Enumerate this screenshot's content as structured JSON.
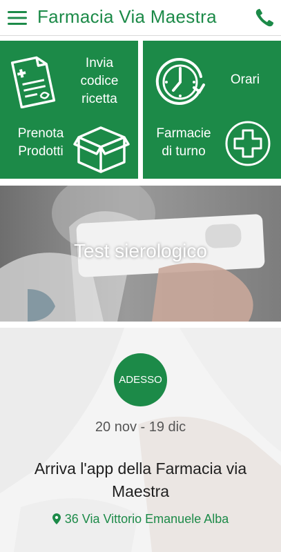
{
  "header": {
    "title": "Farmacia Via Maestra",
    "menu_icon": "hamburger-menu-icon",
    "phone_icon": "phone-icon"
  },
  "tiles": {
    "prescription": {
      "label": "Invia\ncodice\nricetta",
      "icon": "prescription-document-icon"
    },
    "hours": {
      "label": "Orari",
      "icon": "clock-icon"
    },
    "reserve": {
      "label": "Prenota\nProdotti",
      "icon": "box-icon"
    },
    "on_duty": {
      "label": "Farmacie\ndi turno",
      "icon": "pharmacy-cross-icon"
    }
  },
  "banner": {
    "caption": "Test sierologico"
  },
  "event": {
    "badge": "ADESSO",
    "dates": "20 nov - 19 dic",
    "title": "Arriva l'app della Farmacia via Maestra",
    "address": "36 Via Vittorio Emanuele Alba",
    "address_icon": "location-pin-icon"
  },
  "colors": {
    "accent": "#1c8a48",
    "text_dark": "#1f1f1f",
    "text_muted": "#555555"
  }
}
